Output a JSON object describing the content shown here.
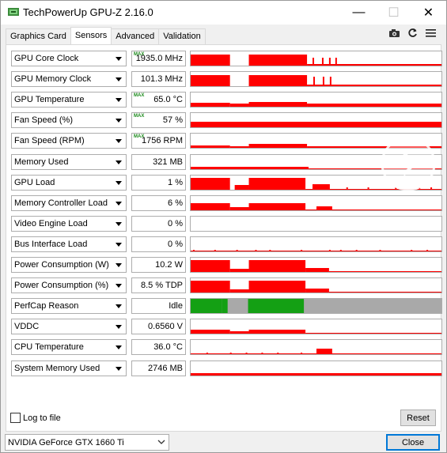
{
  "window": {
    "title": "TechPowerUp GPU-Z 2.16.0",
    "minimize_glyph": "—",
    "maximize_glyph": "☐",
    "close_glyph": "✕"
  },
  "tabs": [
    {
      "label": "Graphics Card",
      "active": false
    },
    {
      "label": "Sensors",
      "active": true
    },
    {
      "label": "Advanced",
      "active": false
    },
    {
      "label": "Validation",
      "active": false
    }
  ],
  "toolbar_icons": [
    "camera-icon",
    "refresh-icon",
    "menu-icon"
  ],
  "colors": {
    "graph_red": "#ff0000",
    "perfcap_green": "#14a014",
    "perfcap_gray": "#a9a9a9",
    "max_tag_green": "#1b8a1b",
    "accent_blue": "#0078d7"
  },
  "sensors": [
    {
      "label": "GPU Core Clock",
      "value": "1935.0 MHz",
      "max": true
    },
    {
      "label": "GPU Memory Clock",
      "value": "101.3 MHz",
      "max": false
    },
    {
      "label": "GPU Temperature",
      "value": "65.0 °C",
      "max": true
    },
    {
      "label": "Fan Speed (%)",
      "value": "57 %",
      "max": true
    },
    {
      "label": "Fan Speed (RPM)",
      "value": "1756 RPM",
      "max": true
    },
    {
      "label": "Memory Used",
      "value": "321 MB",
      "max": false
    },
    {
      "label": "GPU Load",
      "value": "1 %",
      "max": false
    },
    {
      "label": "Memory Controller Load",
      "value": "6 %",
      "max": false
    },
    {
      "label": "Video Engine Load",
      "value": "0 %",
      "max": false
    },
    {
      "label": "Bus Interface Load",
      "value": "0 %",
      "max": false
    },
    {
      "label": "Power Consumption (W)",
      "value": "10.2 W",
      "max": false
    },
    {
      "label": "Power Consumption (%)",
      "value": "8.5 % TDP",
      "max": false
    },
    {
      "label": "PerfCap Reason",
      "value": "Idle",
      "max": false
    },
    {
      "label": "VDDC",
      "value": "0.6560 V",
      "max": false
    },
    {
      "label": "CPU Temperature",
      "value": "36.0 °C",
      "max": false
    },
    {
      "label": "System Memory Used",
      "value": "2746 MB",
      "max": false
    }
  ],
  "max_tag_text": "MAX",
  "log_to_file": {
    "label": "Log to file",
    "checked": false
  },
  "reset_label": "Reset",
  "close_label": "Close",
  "gpu_select": {
    "value": "NVIDIA GeForce GTX 1660 Ti"
  }
}
